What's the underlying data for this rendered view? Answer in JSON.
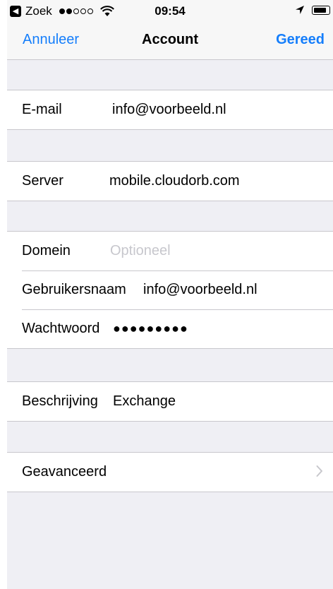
{
  "status_bar": {
    "back_app_glyph": "◀",
    "carrier": "Zoek",
    "signal_bars_filled": 2,
    "signal_bars_total": 5,
    "time": "09:54",
    "icons": [
      "wifi-icon",
      "location-arrow-icon",
      "battery-icon"
    ]
  },
  "nav": {
    "cancel": "Annuleer",
    "title": "Account",
    "done": "Gereed"
  },
  "fields": {
    "email": {
      "label": "E-mail",
      "value": "info@voorbeeld.nl"
    },
    "server": {
      "label": "Server",
      "value": "mobile.cloudorb.com"
    },
    "domain": {
      "label": "Domein",
      "placeholder": "Optioneel"
    },
    "username": {
      "label": "Gebruikersnaam",
      "value": "info@voorbeeld.nl"
    },
    "password": {
      "label": "Wachtwoord",
      "value": "●●●●●●●●●"
    },
    "description": {
      "label": "Beschrijving",
      "value": "Exchange"
    },
    "advanced": {
      "label": "Geavanceerd"
    }
  },
  "colors": {
    "accent": "#157efb",
    "background": "#efeff4",
    "separator": "#c8c7cc",
    "placeholder": "#c7c7cd"
  }
}
